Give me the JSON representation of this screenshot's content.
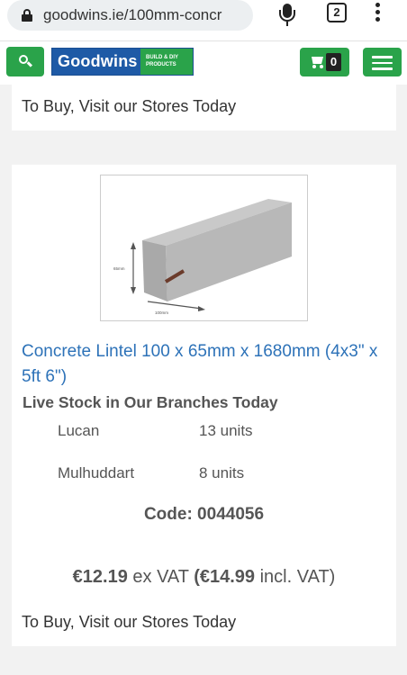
{
  "browser": {
    "url": "goodwins.ie/100mm-concr",
    "tab_count": "2",
    "icons": [
      "lock-icon",
      "mic-icon",
      "tabs-icon",
      "more-vert-icon"
    ]
  },
  "header": {
    "logo_name": "Goodwins",
    "logo_tag_line1": "BUILD & DIY",
    "logo_tag_line2": "PRODUCTS",
    "cart_count": "0",
    "brand_green": "#2aa34a",
    "brand_blue": "#1e5aa6"
  },
  "previous_card": {
    "buy_text": "To Buy, Visit our Stores Today"
  },
  "product": {
    "title": "Concrete Lintel 100 x 65mm x 1680mm (4x3\" x 5ft 6\")",
    "image_labels": {
      "height": "65mm",
      "width": "100mm"
    },
    "stock_heading": "Live Stock in Our Branches Today",
    "stock": [
      {
        "branch": "Lucan",
        "units": "13 units"
      },
      {
        "branch": "Mulhuddart",
        "units": "8 units"
      }
    ],
    "code_text": "Code: 0044056",
    "price_ex_vat": "€12.19",
    "ex_vat_label": " ex VAT ",
    "price_incl_open": "(",
    "price_incl_vat": "€14.99",
    "incl_vat_label": " incl. VAT)",
    "buy_text": "To Buy, Visit our Stores Today",
    "link_color": "#2d72b8"
  }
}
